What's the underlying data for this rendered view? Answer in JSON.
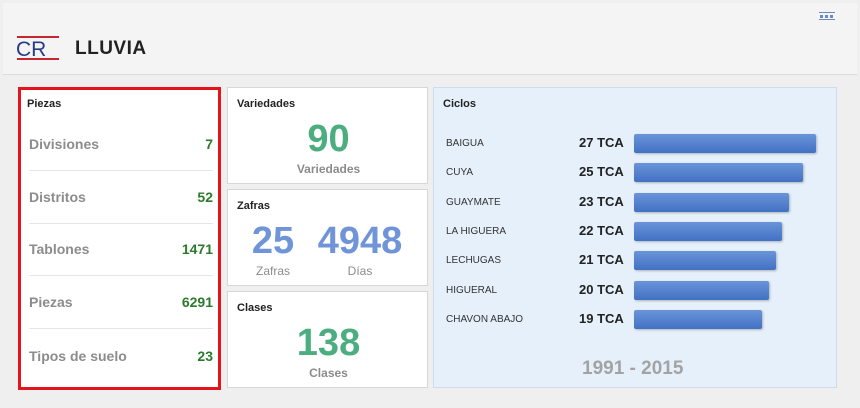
{
  "header": {
    "logo_text": "CR",
    "title": "LLUVIA"
  },
  "piezas": {
    "title": "Piezas",
    "rows": [
      {
        "label": "Divisiones",
        "value": "7"
      },
      {
        "label": "Distritos",
        "value": "52"
      },
      {
        "label": "Tablones",
        "value": "1471"
      },
      {
        "label": "Piezas",
        "value": "6291"
      },
      {
        "label": "Tipos de suelo",
        "value": "23"
      }
    ]
  },
  "variedades": {
    "title": "Variedades",
    "value": "90",
    "label": "Variedades"
  },
  "zafras": {
    "title": "Zafras",
    "zafras_value": "25",
    "zafras_label": "Zafras",
    "dias_value": "4948",
    "dias_label": "Días"
  },
  "clases": {
    "title": "Clases",
    "value": "138",
    "label": "Clases"
  },
  "ciclos": {
    "title": "Ciclos",
    "years": "1991 - 2015",
    "items": [
      {
        "name": "BAIGUA",
        "label": "27 TCA",
        "value": 27
      },
      {
        "name": "CUYA",
        "label": "25 TCA",
        "value": 25
      },
      {
        "name": "GUAYMATE",
        "label": "23 TCA",
        "value": 23
      },
      {
        "name": "LA HIGUERA",
        "label": "22 TCA",
        "value": 22
      },
      {
        "name": "LECHUGAS",
        "label": "21 TCA",
        "value": 21
      },
      {
        "name": "HIGUERAL",
        "label": "20 TCA",
        "value": 20
      },
      {
        "name": "CHAVON ABAJO",
        "label": "19 TCA",
        "value": 19
      }
    ]
  },
  "colors": {
    "accent_green": "#4cae7e",
    "accent_blue": "#6f94d8",
    "value_green": "#2c7a2c",
    "highlight_red": "#e3141a",
    "bar_blue": "#4a78c8"
  }
}
